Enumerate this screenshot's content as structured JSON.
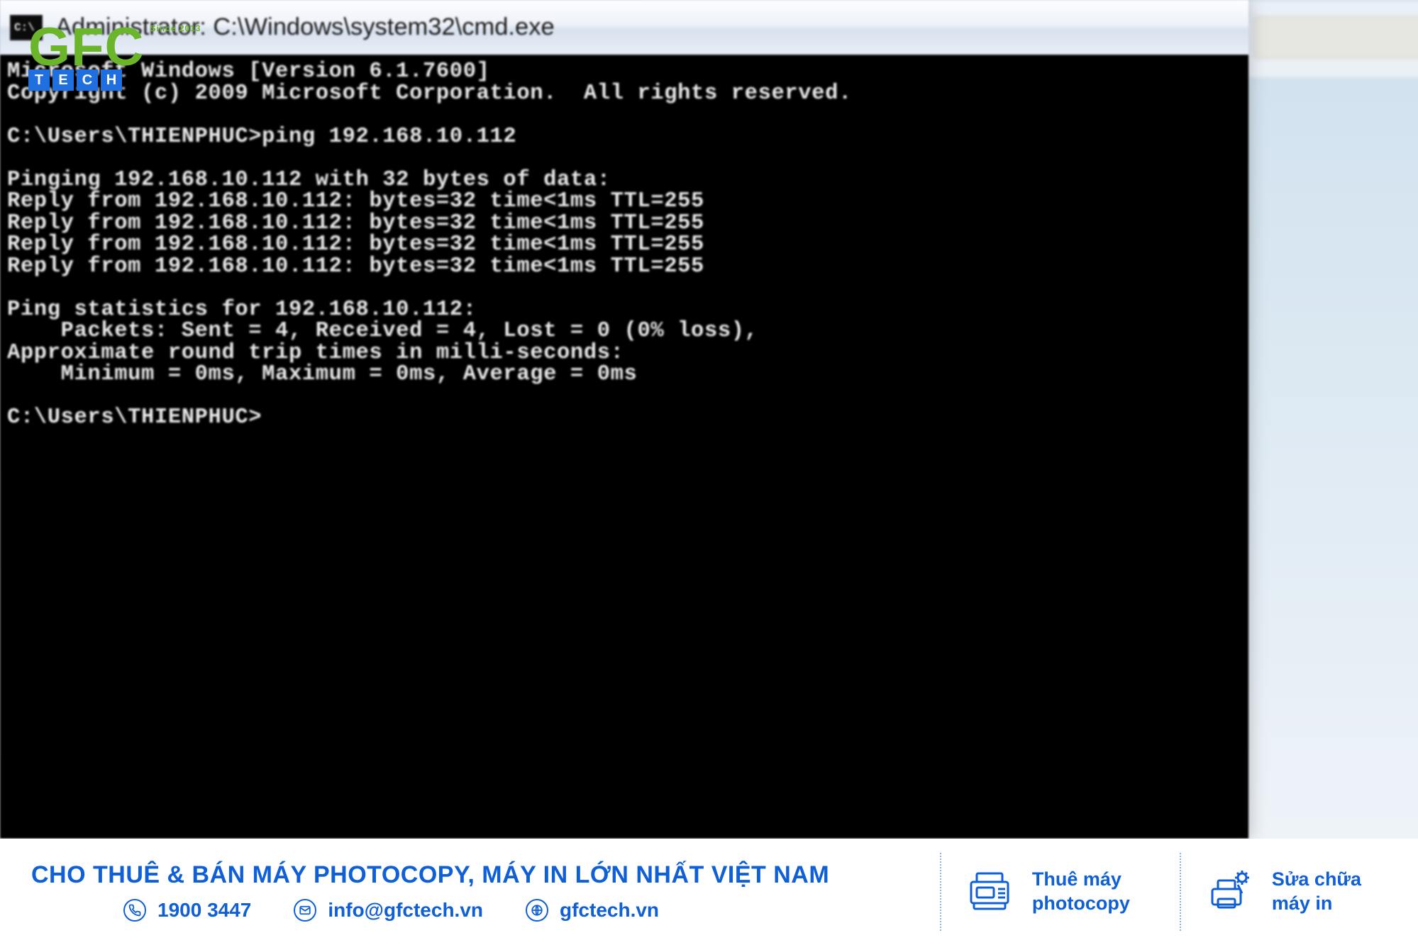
{
  "window": {
    "title": "Administrator: C:\\Windows\\system32\\cmd.exe"
  },
  "terminal": {
    "lines": [
      "Microsoft Windows [Version 6.1.7600]",
      "Copyright (c) 2009 Microsoft Corporation.  All rights reserved.",
      "",
      "C:\\Users\\THIENPHUC>ping 192.168.10.112",
      "",
      "Pinging 192.168.10.112 with 32 bytes of data:",
      "Reply from 192.168.10.112: bytes=32 time<1ms TTL=255",
      "Reply from 192.168.10.112: bytes=32 time<1ms TTL=255",
      "Reply from 192.168.10.112: bytes=32 time<1ms TTL=255",
      "Reply from 192.168.10.112: bytes=32 time<1ms TTL=255",
      "",
      "Ping statistics for 192.168.10.112:",
      "    Packets: Sent = 4, Received = 4, Lost = 0 (0% loss),",
      "Approximate round trip times in milli-seconds:",
      "    Minimum = 0ms, Maximum = 0ms, Average = 0ms",
      "",
      "C:\\Users\\THIENPHUC>"
    ]
  },
  "watermark": {
    "brand_top": "GFC",
    "brand_since": "Since 2013",
    "brand_sub_letters": [
      "T",
      "E",
      "C",
      "H"
    ]
  },
  "footer": {
    "headline": "CHO THUÊ & BÁN MÁY PHOTOCOPY, MÁY IN LỚN NHẤT VIỆT NAM",
    "phone": "1900 3447",
    "email": "info@gfctech.vn",
    "site": "gfctech.vn",
    "svc1_line1": "Thuê máy",
    "svc1_line2": "photocopy",
    "svc2_line1": "Sửa chữa",
    "svc2_line2": "máy in"
  }
}
